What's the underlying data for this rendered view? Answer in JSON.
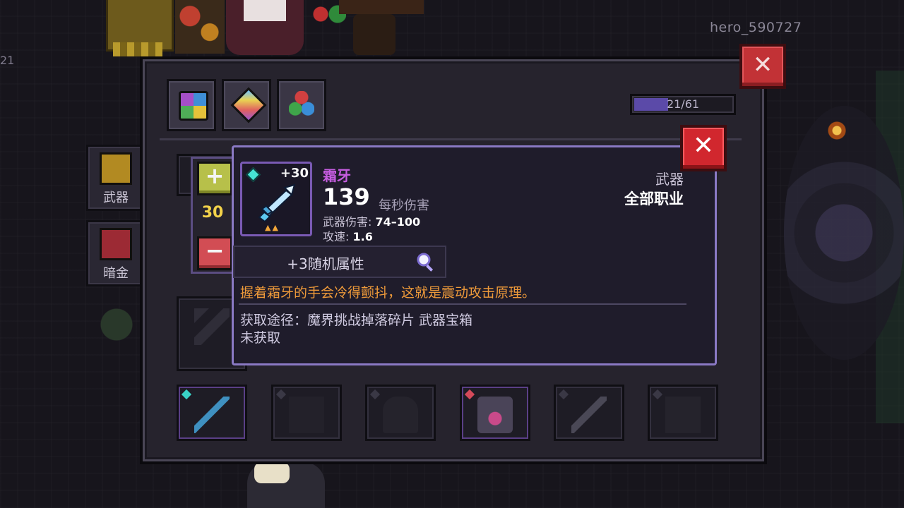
{
  "hud": {
    "player_name": "hero_590727",
    "edge_number": "21"
  },
  "side_tabs": [
    {
      "label": "武器",
      "icon": "weapon-tab-icon"
    },
    {
      "label": "暗金",
      "icon": "dark-gold-tab-icon"
    }
  ],
  "categories": [
    "all-rarity-icon",
    "crystal-icon",
    "gem-trio-icon"
  ],
  "progress": {
    "label": "21/61",
    "current": 21,
    "max": 61
  },
  "stepper": {
    "plus": "+",
    "value": "30",
    "minus": "−"
  },
  "tooltip": {
    "close": "✕",
    "item": {
      "level": "+30",
      "name": "霜牙",
      "dps": "139",
      "dps_label": "每秒伤害",
      "damage_label": "武器伤害:",
      "damage_value": "74–100",
      "speed_label": "攻速:",
      "speed_value": "1.6",
      "type": "武器",
      "class": "全部职业",
      "random_attr": "+3随机属性",
      "flavor": "握着霜牙的手会冷得颤抖，这就是震动攻击原理。",
      "source": "获取途径：魔界挑战掉落碎片 武器宝箱",
      "status": "未获取"
    }
  },
  "panel_close": "✕",
  "colors": {
    "accent_purple": "#8a79c4",
    "item_name": "#c55de0",
    "flavor_text": "#ee9a3a",
    "close_red": "#d1272e",
    "stepper_value": "#f2d24a"
  }
}
